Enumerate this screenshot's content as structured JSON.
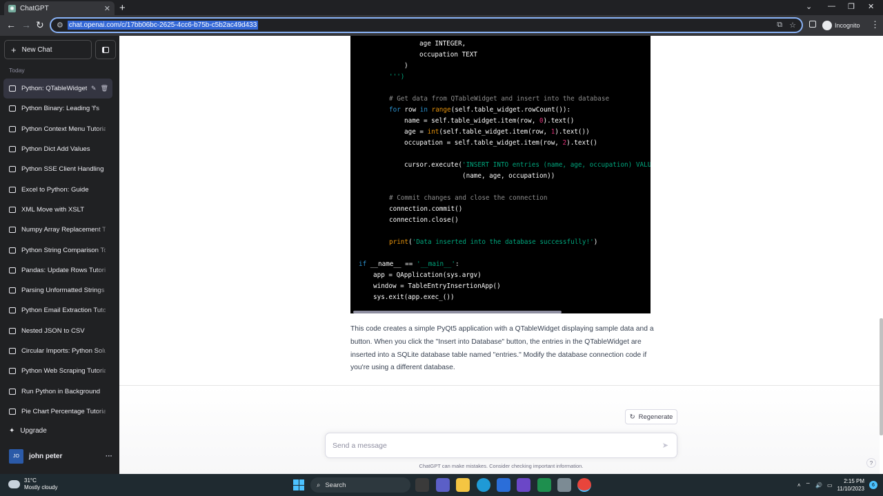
{
  "browser": {
    "tab_title": "ChatGPT",
    "url": "chat.openai.com/c/17bb06bc-2625-4cc6-b75b-c5b2ac49d433",
    "incognito_label": "Incognito"
  },
  "sidebar": {
    "new_chat_label": "New Chat",
    "section_label": "Today",
    "items": [
      {
        "label": "Python: QTableWidget"
      },
      {
        "label": "Python Binary: Leading 'f's"
      },
      {
        "label": "Python Context Menu Tutorial"
      },
      {
        "label": "Python Dict Add Values"
      },
      {
        "label": "Python SSE Client Handling"
      },
      {
        "label": "Excel to Python: Guide"
      },
      {
        "label": "XML Move with XSLT"
      },
      {
        "label": "Numpy Array Replacement Tool"
      },
      {
        "label": "Python String Comparison Tool"
      },
      {
        "label": "Pandas: Update Rows Tutorial"
      },
      {
        "label": "Parsing Unformatted Strings"
      },
      {
        "label": "Python Email Extraction Tutorial"
      },
      {
        "label": "Nested JSON to CSV"
      },
      {
        "label": "Circular Imports: Python Solution"
      },
      {
        "label": "Python Web Scraping Tutorial"
      },
      {
        "label": "Run Python in Background"
      },
      {
        "label": "Pie Chart Percentage Tutorial"
      }
    ],
    "upgrade_label": "Upgrade",
    "user_initials": "JO",
    "user_name": "john peter"
  },
  "code": {
    "l1": "age INTEGER,",
    "l2": "occupation TEXT",
    "l3": ")",
    "l4": "''')",
    "c1": "# Get data from QTableWidget and insert into the database",
    "l5a": "for",
    "l5b": " row ",
    "l5c": "in",
    "l5d": "range",
    "l5e": "(self.table_widget.rowCount()):",
    "l6a": "name = self.table_widget.item(row, ",
    "l6b": "0",
    "l6c": ").text()",
    "l7a": "age = ",
    "l7b": "int",
    "l7c": "(self.table_widget.item(row, ",
    "l7d": "1",
    "l7e": ").text())",
    "l8a": "occupation = self.table_widget.item(row, ",
    "l8b": "2",
    "l8c": ").text()",
    "l9a": "cursor.execute(",
    "l9b": "'INSERT INTO entries (name, age, occupation) VALUES (?, ?, ?)'",
    "l10": "(name, age, occupation))",
    "c2": "# Commit changes and close the connection",
    "l11": "connection.commit()",
    "l12": "connection.close()",
    "l13a": "print",
    "l13b": "(",
    "l13c": "'Data inserted into the database successfully!'",
    "l13d": ")",
    "l14a": "if",
    "l14b": " __name__ == ",
    "l14c": "'__main__'",
    "l14d": ":",
    "l15": "app = QApplication(sys.argv)",
    "l16": "window = TableEntryInsertionApp()",
    "l17": "sys.exit(app.exec_())"
  },
  "response_text": "This code creates a simple PyQt5 application with a QTableWidget displaying sample data and a button. When you click the \"Insert into Database\" button, the entries in the QTableWidget are inserted into a SQLite database table named \"entries.\" Modify the database connection code if you're using a different database.",
  "regenerate_label": "Regenerate",
  "composer": {
    "placeholder": "Send a message"
  },
  "disclaimer": "ChatGPT can make mistakes. Consider checking important information.",
  "help_label": "?",
  "taskbar": {
    "temp": "31°C",
    "weather": "Mostly cloudy",
    "search_label": "Search",
    "time": "2:15 PM",
    "date": "11/10/2023",
    "notif_count": "6"
  }
}
